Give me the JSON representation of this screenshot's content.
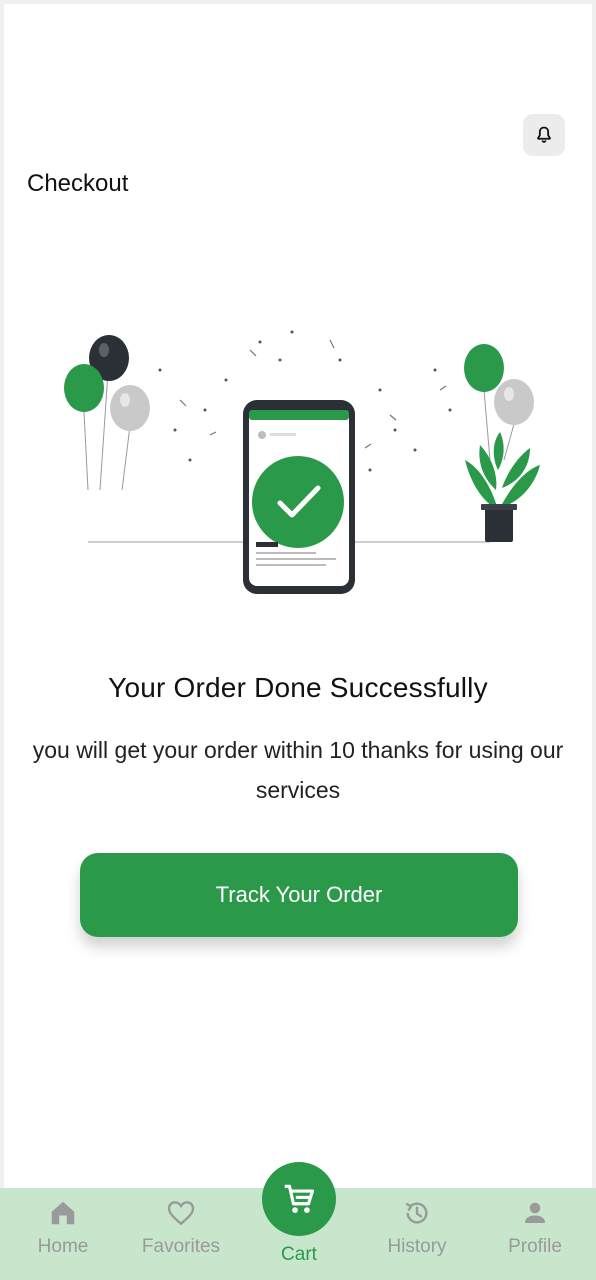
{
  "header": {
    "title": "Checkout",
    "notification_icon": "bell-icon"
  },
  "success": {
    "headline": "Your Order Done Successfully",
    "message": "you will get your order within 10 thanks for using our services",
    "illustration_icon": "order-success-illustration"
  },
  "actions": {
    "track_label": "Track Your Order"
  },
  "bottom_nav": {
    "items": [
      {
        "label": "Home",
        "icon": "home-icon"
      },
      {
        "label": "Favorites",
        "icon": "heart-icon"
      },
      {
        "label": "Cart",
        "icon": "cart-icon",
        "active": true
      },
      {
        "label": "History",
        "icon": "history-icon"
      },
      {
        "label": "Profile",
        "icon": "person-icon"
      }
    ]
  },
  "colors": {
    "accent": "#2a9a4a",
    "nav_background": "#c8e6cc",
    "inactive": "#9a9a9a"
  }
}
